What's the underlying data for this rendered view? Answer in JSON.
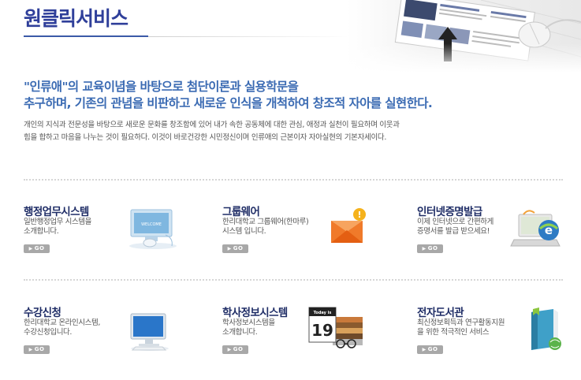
{
  "header": {
    "title": "원클릭서비스"
  },
  "intro": {
    "headline_line1": "\"인류애\"의 교육이념을 바탕으로 첨단이론과 실용학문을",
    "headline_line2": "추구하며, 기존의 관념을 비판하고 새로운 인식을 개척하여 창조적 자아를 실현한다.",
    "description_line1": "개인의 지식과 전문성을 바탕으로 새로운 문화를 창조함에 있어 내가 속한 공동체에 대한 관심, 애정과 실천이 필요하며 이웃과",
    "description_line2": "힘을 합하고 마음을 나누는 것이 필요하다. 이것이 바로건강한 시민정신이며 인류애의 근본이자 자아실현의 기본자세이다."
  },
  "services": [
    {
      "title": "행정업무시스템",
      "desc_line1": "일반행정업무 시스템을",
      "desc_line2": "소개합니다.",
      "button": "GO",
      "icon": "monitor-welcome-icon"
    },
    {
      "title": "그룹웨어",
      "desc_line1": "한리대학교 그룹웨어(한마루)",
      "desc_line2": "시스템 입니다.",
      "button": "GO",
      "icon": "envelope-alert-icon"
    },
    {
      "title": "인터넷증명발급",
      "desc_line1": "이제 인터넷으로 간편하게",
      "desc_line2": "증명서를 발급 받으세요!",
      "button": "GO",
      "icon": "laptop-internet-icon"
    },
    {
      "title": "수강신청",
      "desc_line1": "한리대학교 온라인시스템,",
      "desc_line2": "수강신청입니다.",
      "button": "GO",
      "icon": "desktop-monitor-icon"
    },
    {
      "title": "학사정보시스템",
      "desc_line1": "학사정보시스템을",
      "desc_line2": "소개합니다.",
      "button": "GO",
      "icon": "calendar-books-icon"
    },
    {
      "title": "전자도서관",
      "desc_line1": "최신정보획득과 연구활동지원",
      "desc_line2": "을 위한 적극적인 서비스",
      "button": "GO",
      "icon": "ebook-globe-icon"
    }
  ],
  "icon_text": {
    "welcome_screen": "WELCOME",
    "calendar_today": "Today is",
    "calendar_day": "19"
  },
  "colors": {
    "title": "#2f3f9a",
    "headline": "#3b6bb3",
    "service_title": "#1f2d66",
    "go_button": "#a8a8a8"
  }
}
